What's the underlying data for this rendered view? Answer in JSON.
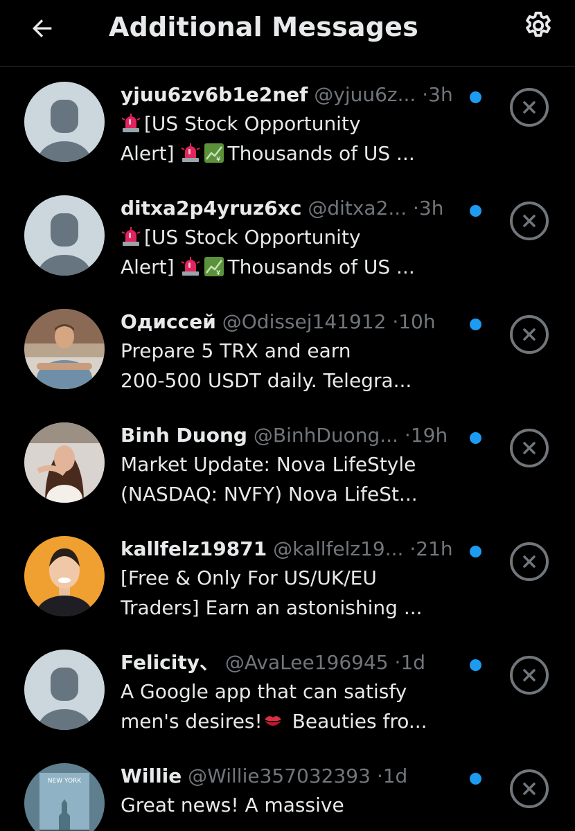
{
  "header": {
    "title": "Additional Messages",
    "back_icon": "arrow-left-icon",
    "settings_icon": "gear-icon"
  },
  "colors": {
    "background": "#000000",
    "text_primary": "#e7e9ea",
    "text_secondary": "#71767b",
    "unread_dot": "#1d9bf0",
    "divider": "#2f3336"
  },
  "messages": [
    {
      "name": "yjuu6zv6b1e2nef",
      "handle": "@yjuu6z...",
      "time": "3h",
      "line1": "[US Stock Opportunity",
      "line2_pre": "Alert]",
      "line2_post": "Thousands of US ...",
      "avatar": "default"
    },
    {
      "name": "ditxa2p4yruz6xc",
      "handle": "@ditxa2...",
      "time": "3h",
      "line1": "[US Stock Opportunity",
      "line2_pre": "Alert]",
      "line2_post": "Thousands of US ...",
      "avatar": "default"
    },
    {
      "name": "Одиссей",
      "handle": "@Odissej141912",
      "time": "10h",
      "line1": "Prepare 5 TRX and earn",
      "line2": "200-500 USDT daily. Telegra...",
      "avatar": "photo-man-sitting"
    },
    {
      "name": "Binh Duong",
      "handle": "@BinhDuong...",
      "time": "19h",
      "line1": "Market Update: Nova LifeStyle",
      "line2": "(NASDAQ: NVFY) Nova LifeSt...",
      "avatar": "photo-woman"
    },
    {
      "name": "kallfelz19871",
      "handle": "@kallfelz19...",
      "time": "21h",
      "line1": "[Free & Only For US/UK/EU",
      "line2": "Traders] Earn an astonishing ...",
      "avatar": "photo-man-orange"
    },
    {
      "name": "Felicity、",
      "handle": "@AvaLee196945",
      "time": "1d",
      "line1": "A Google app that can satisfy",
      "line2_pre": "men's desires!",
      "line2_post": "Beauties fro...",
      "avatar": "default"
    },
    {
      "name": "Willie",
      "handle": "@Willie357032393",
      "time": "1d",
      "line1": "Great news!  A massive",
      "avatar_text": "NEW YORK",
      "avatar": "poster-new-york"
    }
  ],
  "time_separator": "·"
}
